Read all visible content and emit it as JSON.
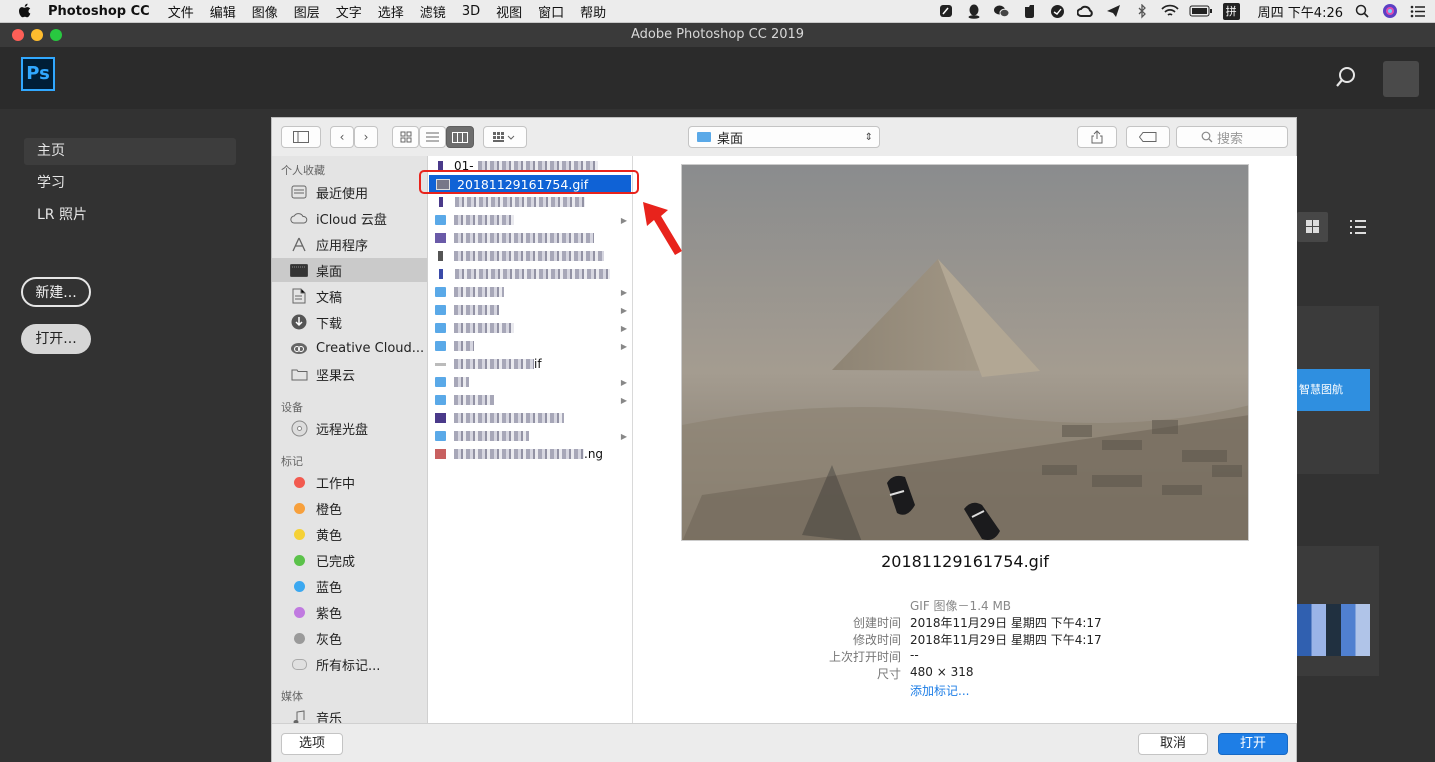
{
  "menubar": {
    "app_name": "Photoshop CC",
    "items": [
      "文件",
      "编辑",
      "图像",
      "图层",
      "文字",
      "选择",
      "滤镜",
      "3D",
      "视图",
      "窗口",
      "帮助"
    ],
    "clock": "周四 下午4:26",
    "input_method": "拼"
  },
  "window": {
    "title": "Adobe Photoshop CC 2019"
  },
  "ps": {
    "logo": "Ps",
    "nav": [
      "主页",
      "学习",
      "LR 照片"
    ],
    "new_button": "新建...",
    "open_button": "打开...",
    "promo_text": "智慧图航"
  },
  "dialog": {
    "location": "桌面",
    "search_placeholder": "搜索",
    "sidebar": {
      "favorites_heading": "个人收藏",
      "favorites": [
        {
          "label": "最近使用",
          "icon": "recents-icon"
        },
        {
          "label": "iCloud 云盘",
          "icon": "cloud-icon"
        },
        {
          "label": "应用程序",
          "icon": "applications-icon"
        },
        {
          "label": "桌面",
          "icon": "desktop-icon"
        },
        {
          "label": "文稿",
          "icon": "documents-icon"
        },
        {
          "label": "下载",
          "icon": "download-icon"
        },
        {
          "label": "Creative Cloud...",
          "icon": "creative-cloud-icon"
        },
        {
          "label": "坚果云",
          "icon": "folder-icon"
        }
      ],
      "devices_heading": "设备",
      "devices": [
        {
          "label": "远程光盘",
          "icon": "disc-icon"
        }
      ],
      "tags_heading": "标记",
      "tags": [
        {
          "label": "工作中",
          "color": "#f25a4f"
        },
        {
          "label": "橙色",
          "color": "#f7a03c"
        },
        {
          "label": "黄色",
          "color": "#f5d136"
        },
        {
          "label": "已完成",
          "color": "#5bc24a"
        },
        {
          "label": "蓝色",
          "color": "#3ba8f0"
        },
        {
          "label": "紫色",
          "color": "#c07ae0"
        },
        {
          "label": "灰色",
          "color": "#9a9a9a"
        },
        {
          "label": "所有标记...",
          "color": "#e0e0e0"
        }
      ],
      "media_heading": "媒体",
      "media": [
        {
          "label": "音乐",
          "icon": "music-icon"
        }
      ]
    },
    "files": [
      {
        "name": "01-",
        "kind": "file",
        "arrow": false
      },
      {
        "name": "20181129161754.gif",
        "kind": "image",
        "arrow": false,
        "selected": true
      },
      {
        "name": "",
        "kind": "file",
        "arrow": false
      },
      {
        "name": "",
        "kind": "folder",
        "arrow": true
      },
      {
        "name": "",
        "kind": "image",
        "arrow": false
      },
      {
        "name": "",
        "kind": "file",
        "arrow": false
      },
      {
        "name": "",
        "kind": "file",
        "arrow": false
      },
      {
        "name": "",
        "kind": "folder",
        "arrow": true
      },
      {
        "name": "",
        "kind": "folder",
        "arrow": true
      },
      {
        "name": "",
        "kind": "folder",
        "arrow": true
      },
      {
        "name": "",
        "kind": "folder",
        "arrow": true
      },
      {
        "name": "if",
        "kind": "file",
        "arrow": false
      },
      {
        "name": "",
        "kind": "folder",
        "arrow": true
      },
      {
        "name": "",
        "kind": "folder",
        "arrow": true
      },
      {
        "name": "",
        "kind": "image",
        "arrow": false
      },
      {
        "name": "",
        "kind": "folder",
        "arrow": true
      },
      {
        "name": ".ng",
        "kind": "image",
        "arrow": false
      }
    ],
    "preview": {
      "filename": "20181129161754.gif",
      "kind_size": "GIF 图像－1.4 MB",
      "meta": [
        {
          "key": "创建时间",
          "value": "2018年11月29日 星期四 下午4:17"
        },
        {
          "key": "修改时间",
          "value": "2018年11月29日 星期四 下午4:17"
        },
        {
          "key": "上次打开时间",
          "value": "--"
        },
        {
          "key": "尺寸",
          "value": "480 × 318"
        }
      ],
      "add_tags": "添加标记..."
    },
    "options_button": "选项",
    "cancel_button": "取消",
    "open_button": "打开"
  },
  "colors": {
    "accent": "#1e7ee6",
    "highlight_box": "#e8231c",
    "selection": "#0f62d6"
  }
}
